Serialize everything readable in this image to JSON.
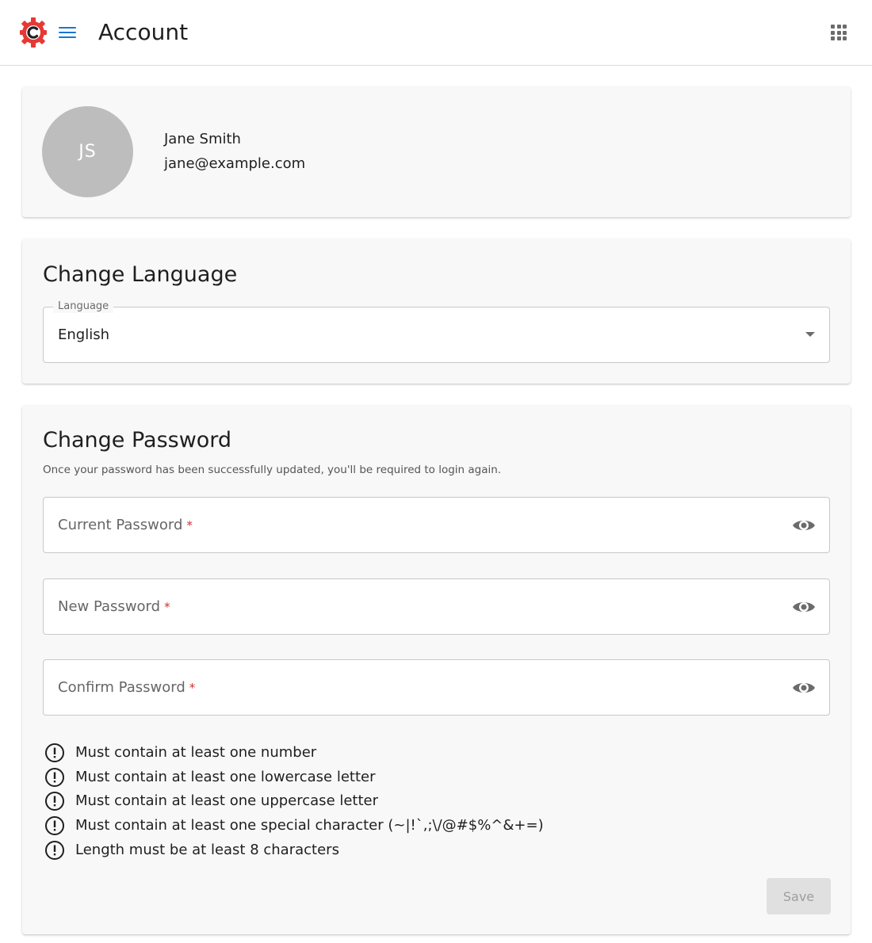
{
  "header": {
    "title": "Account",
    "accent_color": "#1976d2",
    "logo_color": "#e53935",
    "logo_letter": "C"
  },
  "profile": {
    "initials": "JS",
    "name": "Jane Smith",
    "email": "jane@example.com"
  },
  "language_section": {
    "title": "Change Language",
    "select_label": "Language",
    "selected_value": "English"
  },
  "password_section": {
    "title": "Change Password",
    "subtitle": "Once your password has been successfully updated, you'll be required to login again.",
    "fields": [
      {
        "label": "Current Password",
        "required_mark": "*"
      },
      {
        "label": "New Password",
        "required_mark": "*"
      },
      {
        "label": "Confirm Password",
        "required_mark": "*"
      }
    ],
    "requirements": [
      "Must contain at least one number",
      "Must contain at least one lowercase letter",
      "Must contain at least one uppercase letter",
      "Must contain at least one special character (~|!`,;\\/@#$%^&+=)",
      "Length must be at least 8 characters"
    ],
    "save_label": "Save"
  }
}
